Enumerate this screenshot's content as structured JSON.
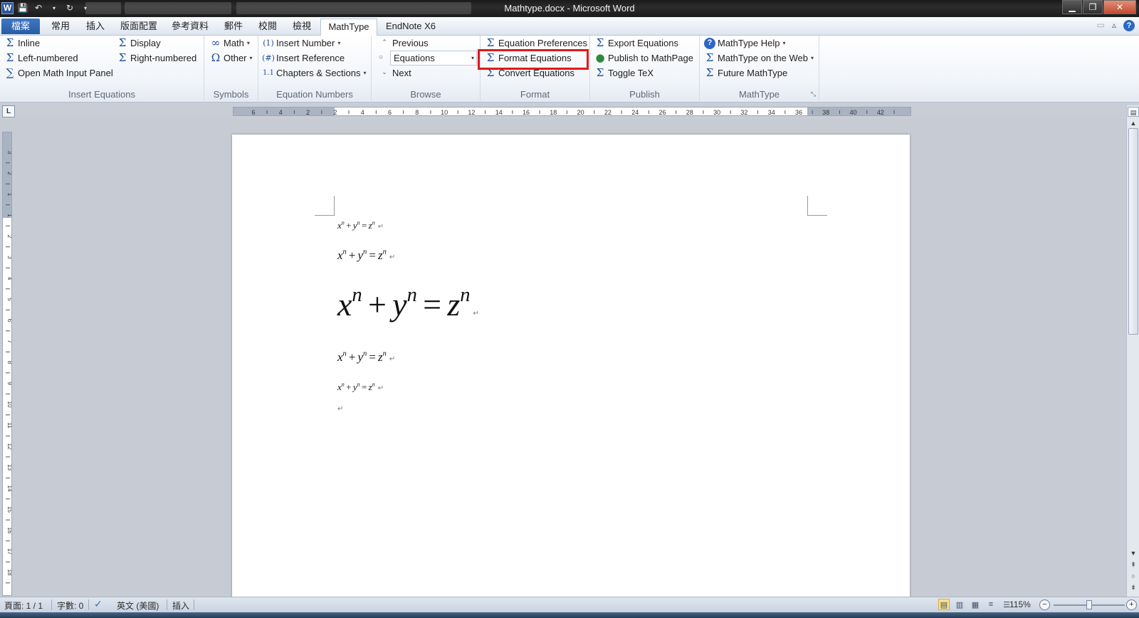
{
  "window": {
    "title": "Mathtype.docx - Microsoft Word",
    "app_icon": "W"
  },
  "tabs": [
    {
      "label": "檔案",
      "id": "file"
    },
    {
      "label": "常用",
      "id": "home"
    },
    {
      "label": "插入",
      "id": "insert"
    },
    {
      "label": "版面配置",
      "id": "layout"
    },
    {
      "label": "參考資料",
      "id": "references"
    },
    {
      "label": "郵件",
      "id": "mailings"
    },
    {
      "label": "校閱",
      "id": "review"
    },
    {
      "label": "檢視",
      "id": "view"
    },
    {
      "label": "MathType",
      "id": "mathtype"
    },
    {
      "label": "EndNote X6",
      "id": "endnote"
    }
  ],
  "active_tab": "MathType",
  "ribbon": {
    "insert_equations": {
      "label": "Insert Equations",
      "inline": "Inline",
      "display": "Display",
      "left_numbered": "Left-numbered",
      "right_numbered": "Right-numbered",
      "open_panel": "Open Math Input Panel"
    },
    "symbols": {
      "label": "Symbols",
      "math": "Math",
      "other": "Other"
    },
    "equation_numbers": {
      "label": "Equation Numbers",
      "insert_number": "Insert Number",
      "insert_reference": "Insert Reference",
      "chapters_sections": "Chapters & Sections"
    },
    "browse": {
      "label": "Browse",
      "previous": "Previous",
      "combo_value": "Equations",
      "next": "Next"
    },
    "format": {
      "label": "Format",
      "equation_preferences": "Equation Preferences",
      "format_equations": "Format Equations",
      "convert_equations": "Convert Equations"
    },
    "publish": {
      "label": "Publish",
      "export_equations": "Export Equations",
      "publish_mathpage": "Publish to MathPage",
      "toggle_tex": "Toggle TeX"
    },
    "mathtype": {
      "label": "MathType",
      "help": "MathType Help",
      "on_web": "MathType on the Web",
      "future": "Future MathType"
    }
  },
  "highlight": {
    "target": "Format Equations",
    "color": "#e01a1a"
  },
  "ruler": {
    "h_labels": [
      "6",
      "4",
      "2",
      "2",
      "4",
      "6",
      "8",
      "10",
      "12",
      "14",
      "16",
      "18",
      "20",
      "22",
      "24",
      "26",
      "28",
      "30",
      "32",
      "34",
      "36",
      "38",
      "40",
      "42"
    ],
    "v_labels": [
      "3",
      "2",
      "1",
      "1",
      "2",
      "3",
      "4",
      "5",
      "6",
      "7",
      "8",
      "9",
      "10",
      "11",
      "12",
      "13",
      "14",
      "15",
      "16",
      "17",
      "18"
    ]
  },
  "document": {
    "equations": [
      {
        "base": [
          "x",
          "y",
          "z"
        ],
        "exp": "n",
        "ops": [
          "+",
          "="
        ]
      },
      {
        "base": [
          "x",
          "y",
          "z"
        ],
        "exp": "n",
        "ops": [
          "+",
          "="
        ]
      },
      {
        "base": [
          "x",
          "y",
          "z"
        ],
        "exp": "n",
        "ops": [
          "+",
          "="
        ]
      },
      {
        "base": [
          "x",
          "y",
          "z"
        ],
        "exp": "n",
        "ops": [
          "+",
          "="
        ]
      },
      {
        "base": [
          "x",
          "y",
          "z"
        ],
        "exp": "n",
        "ops": [
          "+",
          "="
        ]
      }
    ],
    "paragraph_mark": "↵"
  },
  "status": {
    "page": "頁面: 1 / 1",
    "words": "字數: 0",
    "language": "英文 (美國)",
    "mode": "插入",
    "zoom": "115%"
  },
  "colors": {
    "file_tab": "#2a5ba4",
    "accent": "#1f4e9a",
    "highlight": "#e01a1a"
  }
}
